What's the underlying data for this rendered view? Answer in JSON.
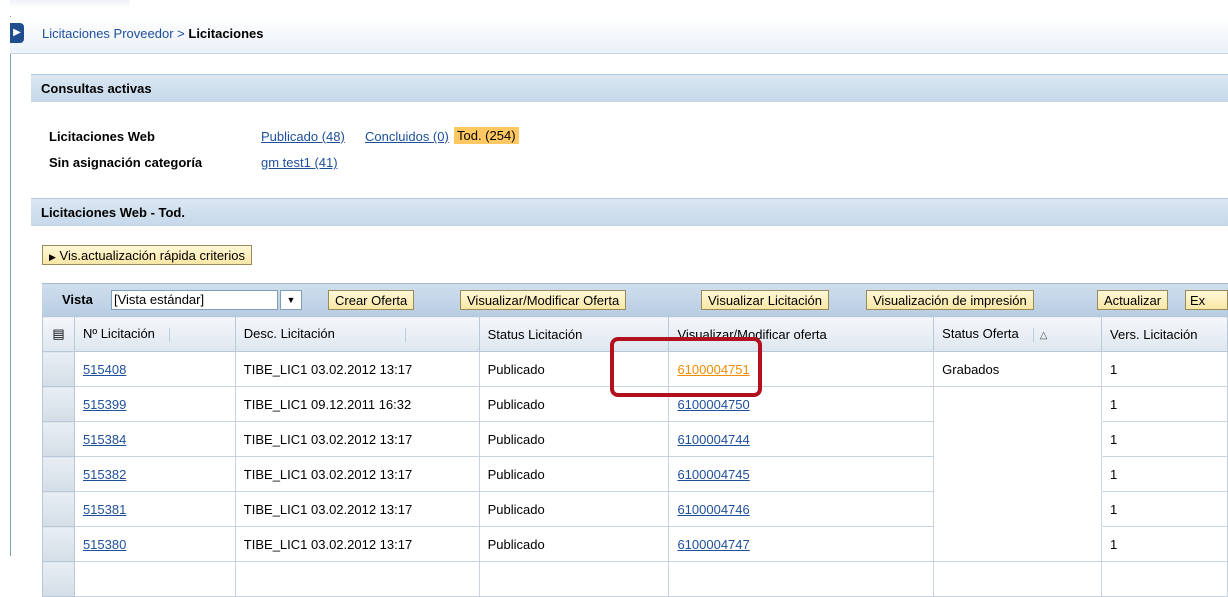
{
  "breadcrumb": {
    "parent": "Licitaciones Proveedor",
    "separator": ">",
    "current": "Licitaciones"
  },
  "consultas": {
    "title": "Consultas activas",
    "rows": [
      {
        "label": "Licitaciones Web",
        "links": [
          "Publicado (48)",
          "Concluidos (0)"
        ],
        "selected": "Tod. (254)"
      },
      {
        "label": "Sin asignación categoría",
        "links": [
          "gm test1 (41)"
        ]
      }
    ]
  },
  "results": {
    "title": "Licitaciones Web - Tod.",
    "quick_criteria_button": "Vis.actualización rápida criterios",
    "toolbar": {
      "vista_label": "Vista",
      "vista_value": "[Vista estándar]",
      "buttons": [
        "Crear Oferta",
        "Visualizar/Modificar Oferta",
        "Visualizar Licitación",
        "Visualización de impresión",
        "Actualizar",
        "Ex"
      ]
    },
    "columns": [
      "Nº Licitación",
      "Desc. Licitación",
      "Status Licitación",
      "Visualizar/Modificar oferta",
      "Status Oferta",
      "Vers. Licitación"
    ],
    "rows": [
      [
        "515408",
        "TIBE_LIC1 03.02.2012 13:17",
        "Publicado",
        "6100004751",
        "Grabados",
        "1"
      ],
      [
        "515399",
        "TIBE_LIC1 09.12.2011 16:32",
        "Publicado",
        "6100004750",
        "",
        "1"
      ],
      [
        "515384",
        "TIBE_LIC1 03.02.2012 13:17",
        "Publicado",
        "6100004744",
        "",
        "1"
      ],
      [
        "515382",
        "TIBE_LIC1 03.02.2012 13:17",
        "Publicado",
        "6100004745",
        "",
        "1"
      ],
      [
        "515381",
        "TIBE_LIC1 03.02.2012 13:17",
        "Publicado",
        "6100004746",
        "",
        "1"
      ],
      [
        "515380",
        "TIBE_LIC1 03.02.2012 13:17",
        "Publicado",
        "6100004747",
        "",
        "1"
      ]
    ]
  },
  "icons": {
    "nav_arrow": "play-arrow-icon",
    "expand": "triangle-right-icon",
    "dropdown": "chevron-down-icon",
    "column_settings": "table-settings-icon",
    "sort": "sort-icon"
  },
  "colors": {
    "link": "#1e4f9c",
    "active_link": "#f08c00",
    "selected_query": "#ffc862",
    "highlight_box": "#b2101e"
  }
}
